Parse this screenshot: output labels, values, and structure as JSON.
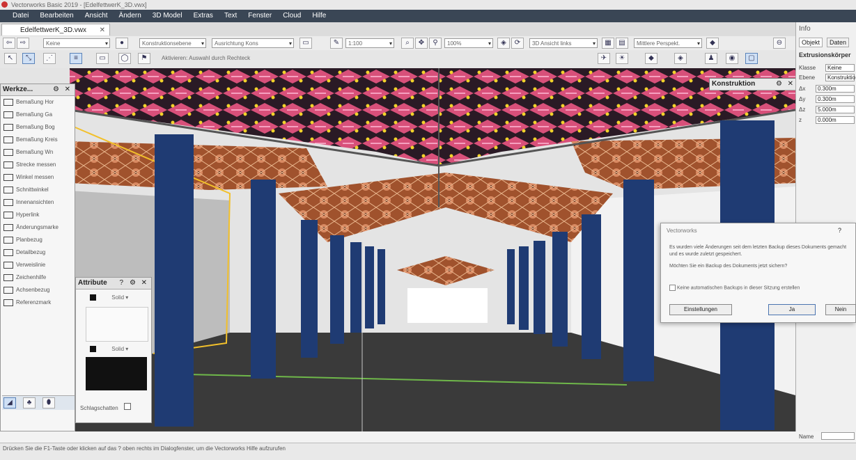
{
  "window": {
    "title": "Vectorworks Basic 2019 - [EdelfettwerK_3D.vwx]"
  },
  "menu": [
    "Datei",
    "Bearbeiten",
    "Ansicht",
    "Ändern",
    "3D Model",
    "Extras",
    "Text",
    "Fenster",
    "Cloud",
    "Hilfe"
  ],
  "document_tab": {
    "label": "EdelfettwerK_3D.vwx"
  },
  "toolbar1": {
    "class_dropdown": "Keine",
    "layer_dropdown": "Konstruktionsebene",
    "alignment_dropdown": "Ausrichtung Kons",
    "scale_field": "1:100",
    "zoom_field": "100%",
    "view_dropdown": "3D Ansicht links",
    "perspective_dropdown": "Mittlere Perspekt."
  },
  "toolbar2": {
    "mode_hint": "Aktivieren: Auswahl durch Rechteck"
  },
  "tools_palette": {
    "title": "Werkze...",
    "items": [
      "Bemaßung Hor",
      "Bemaßung Ga",
      "Bemaßung Bog",
      "Bemaßung Kreis",
      "Bemaßung Wn",
      "Strecke messen",
      "Winkel messen",
      "Schnittwinkel",
      "Innenansichten",
      "Hyperlink",
      "Änderungsmarke",
      "Planbezug",
      "Detailbezug",
      "Verweislinie",
      "Zeichenhilfe",
      "Achsenbezug",
      "Referenzmark"
    ]
  },
  "attributes_palette": {
    "title": "Attribute",
    "fill_style": "Solid",
    "pen_style": "Solid",
    "opacity_label": "Schlagschatten"
  },
  "construction_palette": {
    "title": "Konstruktion"
  },
  "info_panel": {
    "title": "Info",
    "tabs": [
      "Objekt",
      "Daten"
    ],
    "object_type": "Extrusionskörper",
    "class_label": "Klasse",
    "class_value": "Keine",
    "layer_label": "Ebene",
    "layer_value": "Konstruktio",
    "fields": [
      {
        "label": "Δx",
        "value": "0.300m"
      },
      {
        "label": "Δy",
        "value": "0.300m"
      },
      {
        "label": "Δz",
        "value": "5.000m"
      },
      {
        "label": "z",
        "value": "0.000m"
      }
    ],
    "footer_label": "Name"
  },
  "dialog": {
    "title": "Vectorworks",
    "help": "?",
    "message": "Es wurden viele Änderungen seit dem letzten Backup dieses Dokuments gemacht und es wurde zuletzt gespeichert.",
    "question": "Möchten Sie ein Backup des Dokuments jetzt sichern?",
    "checkbox_label": "Keine automatischen Backups in dieser Sitzung erstellen",
    "buttons": {
      "settings": "Einstellungen",
      "yes": "Ja",
      "no": "Nein"
    }
  },
  "status": {
    "hint": "Drücken Sie die F1-Taste oder klicken auf das ? oben rechts im Dialogfenster, um die Vectorworks Hilfe aufzurufen"
  },
  "colors": {
    "menubar": "#3a4655",
    "column": "#1f3b73",
    "ceiling_pink": "#d8507a",
    "floor": "#3a3a3a"
  }
}
